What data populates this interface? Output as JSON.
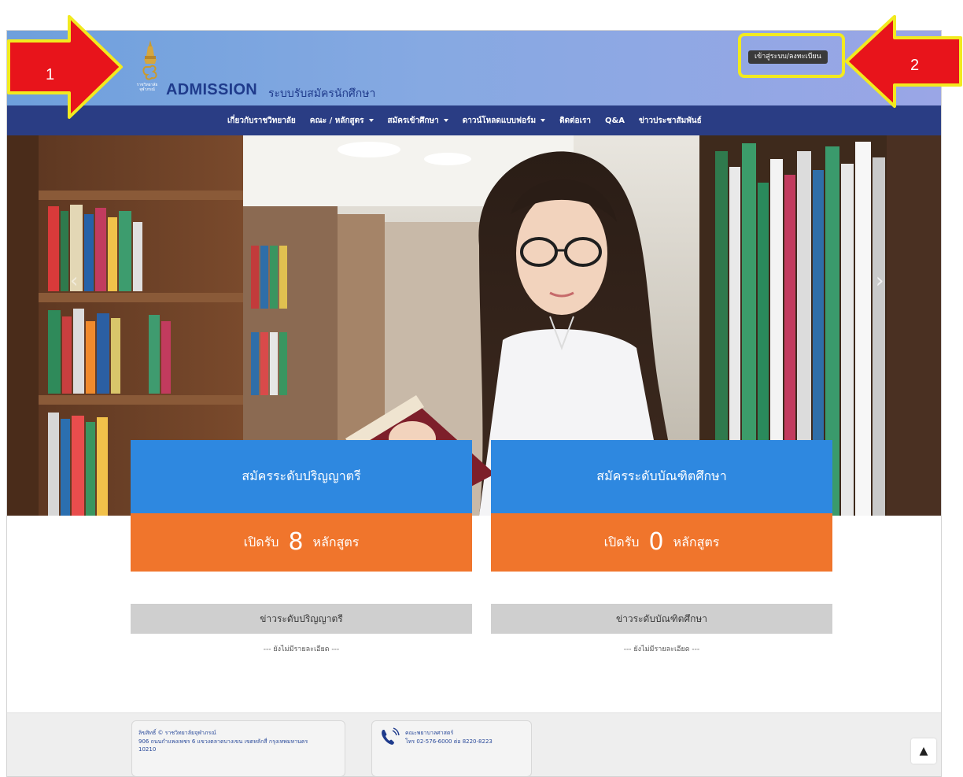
{
  "header": {
    "logo_subtext": "ราชวิทยาลัย จุฬาภรณ์",
    "brand": "ADMISSION",
    "tagline": "ระบบรับสมัครนักศึกษา",
    "login_label": "เข้าสู่ระบบ/ลงทะเบียน"
  },
  "nav": {
    "items": [
      {
        "label": "เกี่ยวกับราชวิทยาลัย",
        "dropdown": false
      },
      {
        "label": "คณะ / หลักสูตร",
        "dropdown": true
      },
      {
        "label": "สมัครเข้าศึกษา",
        "dropdown": true
      },
      {
        "label": "ดาวน์โหลดแบบฟอร์ม",
        "dropdown": true
      },
      {
        "label": "ติดต่อเรา",
        "dropdown": false
      },
      {
        "label": "Q&A",
        "dropdown": false
      },
      {
        "label": "ข่าวประชาสัมพันธ์",
        "dropdown": false
      }
    ]
  },
  "hero": {
    "prev_icon": "‹",
    "next_icon": "›"
  },
  "cards": {
    "undergrad": {
      "title": "สมัครระดับปริญญาตรี",
      "prefix": "เปิดรับ",
      "count": "8",
      "suffix": "หลักสูตร"
    },
    "graduate": {
      "title": "สมัครระดับบัณฑิตศึกษา",
      "prefix": "เปิดรับ",
      "count": "0",
      "suffix": "หลักสูตร"
    }
  },
  "news": {
    "undergrad": {
      "title": "ข่าวระดับปริญญาตรี",
      "empty": "--- ยังไม่มีรายละเอียด ---"
    },
    "graduate": {
      "title": "ข่าวระดับบัณฑิตศึกษา",
      "empty": "--- ยังไม่มีรายละเอียด ---"
    }
  },
  "footer": {
    "address_line1": "ลิขสิทธิ์ © ราชวิทยาลัยจุฬาภรณ์",
    "address_line2": "906 ถนนกำแพงเพชร 6 แขวงตลาดบางเขน เขตหลักสี่ กรุงเทพมหานคร",
    "address_line3": "10210",
    "contact_name": "คณะพยาบาลศาสตร์",
    "contact_tel": "โทร 02-576-6000 ต่อ 8220-8223",
    "to_top_icon": "▲"
  },
  "annotations": {
    "arrow_1": "1",
    "arrow_2": "2",
    "arrow_color": "#e8141b",
    "outline_color": "#f2ea1f"
  },
  "colors": {
    "navbar": "#2a3d84",
    "card_blue": "#2e88e0",
    "card_orange": "#f0752c",
    "news_header": "#cfcfcf"
  }
}
